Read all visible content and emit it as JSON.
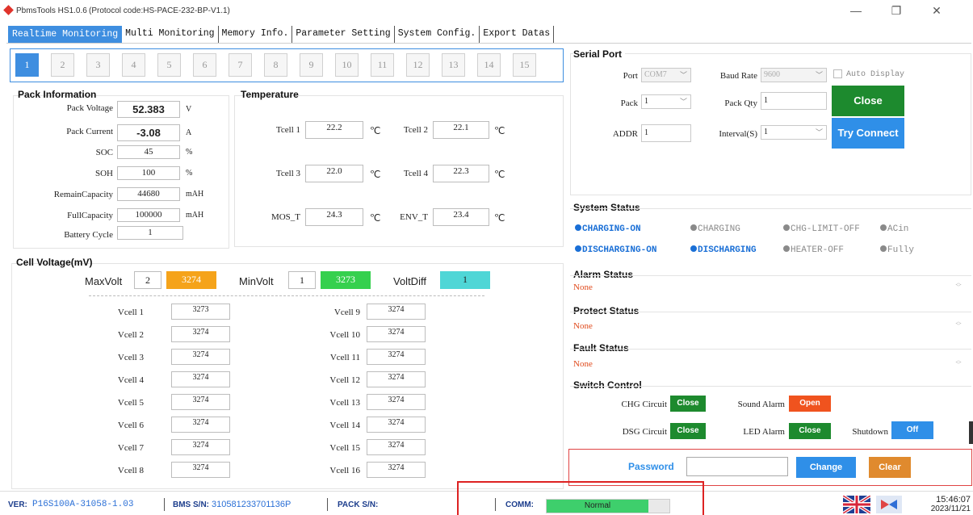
{
  "window": {
    "app_title": "PbmsTools HS1.0.6",
    "protocol": "(Protocol code:HS-PACE-232-BP-V1.1)",
    "minimize": "—",
    "maximize": "❐",
    "close": "✕"
  },
  "tabs": [
    "Realtime Monitoring",
    "Multi Monitoring",
    "Memory Info.",
    "Parameter Setting",
    "System Config.",
    "Export Datas"
  ],
  "pack_tiles": [
    "1",
    "2",
    "3",
    "4",
    "5",
    "6",
    "7",
    "8",
    "9",
    "10",
    "11",
    "12",
    "13",
    "14",
    "15"
  ],
  "pack_info": {
    "title": "Pack Information",
    "pack_voltage_label": "Pack Voltage",
    "pack_voltage": "52.383",
    "pack_voltage_unit": "V",
    "pack_current_label": "Pack Current",
    "pack_current": "-3.08",
    "pack_current_unit": "A",
    "soc_label": "SOC",
    "soc": "45",
    "soc_unit": "%",
    "soh_label": "SOH",
    "soh": "100",
    "soh_unit": "%",
    "remain_label": "RemainCapacity",
    "remain": "44680",
    "remain_unit": "mAH",
    "full_label": "FullCapacity",
    "full": "100000",
    "full_unit": "mAH",
    "cycle_label": "Battery Cycle",
    "cycle": "1"
  },
  "temperature": {
    "title": "Temperature",
    "unit": "℃",
    "tcell1_label": "Tcell 1",
    "tcell1": "22.2",
    "tcell2_label": "Tcell 2",
    "tcell2": "22.1",
    "tcell3_label": "Tcell 3",
    "tcell3": "22.0",
    "tcell4_label": "Tcell 4",
    "tcell4": "22.3",
    "mos_label": "MOS_T",
    "mos": "24.3",
    "env_label": "ENV_T",
    "env": "23.4"
  },
  "cell_voltage": {
    "title": "Cell Voltage(mV)",
    "maxvolt_label": "MaxVolt",
    "maxvolt_cell": "2",
    "maxvolt_value": "3274",
    "minvolt_label": "MinVolt",
    "minvolt_cell": "1",
    "minvolt_value": "3273",
    "voltdiff_label": "VoltDiff",
    "voltdiff_value": "1",
    "colors": {
      "max": "#f5a31a",
      "min": "#35d04e",
      "diff": "#4fd6d6"
    },
    "cells": [
      {
        "label": "Vcell 1",
        "value": "3273"
      },
      {
        "label": "Vcell 2",
        "value": "3274"
      },
      {
        "label": "Vcell 3",
        "value": "3274"
      },
      {
        "label": "Vcell 4",
        "value": "3274"
      },
      {
        "label": "Vcell 5",
        "value": "3274"
      },
      {
        "label": "Vcell 6",
        "value": "3274"
      },
      {
        "label": "Vcell 7",
        "value": "3274"
      },
      {
        "label": "Vcell 8",
        "value": "3274"
      },
      {
        "label": "Vcell 9",
        "value": "3274"
      },
      {
        "label": "Vcell 10",
        "value": "3274"
      },
      {
        "label": "Vcell 11",
        "value": "3274"
      },
      {
        "label": "Vcell 12",
        "value": "3274"
      },
      {
        "label": "Vcell 13",
        "value": "3274"
      },
      {
        "label": "Vcell 14",
        "value": "3274"
      },
      {
        "label": "Vcell 15",
        "value": "3274"
      },
      {
        "label": "Vcell 16",
        "value": "3274"
      }
    ]
  },
  "serial": {
    "title": "Serial Port",
    "port_label": "Port",
    "port": "COM7",
    "baud_label": "Baud Rate",
    "baud": "9600",
    "auto_display": "Auto Display",
    "pack_label": "Pack",
    "pack": "1",
    "pack_qty_label": "Pack Qty",
    "pack_qty": "1",
    "close_btn": "Close",
    "addr_label": "ADDR",
    "addr": "1",
    "interval_label": "Interval(S)",
    "interval": "1",
    "try_connect_btn": "Try Connect"
  },
  "system_status": {
    "title": "System Status",
    "items": [
      {
        "label": "CHARGING-ON",
        "active": true
      },
      {
        "label": "CHARGING",
        "active": false
      },
      {
        "label": "CHG-LIMIT-OFF",
        "active": false
      },
      {
        "label": "ACin",
        "active": false
      },
      {
        "label": "DISCHARGING-ON",
        "active": true
      },
      {
        "label": "DISCHARGING",
        "active": true
      },
      {
        "label": "HEATER-OFF",
        "active": false
      },
      {
        "label": "Fully",
        "active": false
      }
    ],
    "colors": {
      "active": "#1a6fd6",
      "inactive": "#8a8a8a"
    }
  },
  "alarm": {
    "title": "Alarm Status",
    "value": "None"
  },
  "protect": {
    "title": "Protect Status",
    "value": "None"
  },
  "fault": {
    "title": "Fault Status",
    "value": "None"
  },
  "switch_control": {
    "title": "Switch Control",
    "chg_label": "CHG Circuit",
    "chg_btn": "Close",
    "sound_label": "Sound Alarm",
    "sound_btn": "Open",
    "dsg_label": "DSG Circuit",
    "dsg_btn": "Close",
    "led_label": "LED Alarm",
    "led_btn": "Close",
    "shutdown_label": "Shutdown",
    "shutdown_btn": "Off"
  },
  "password": {
    "label": "Password",
    "value": "",
    "change_btn": "Change",
    "clear_btn": "Clear"
  },
  "footer": {
    "ver_label": "VER:",
    "ver": "P16S100A-31058-1.03",
    "bms_label": "BMS S/N:",
    "bms": "310581233701136P",
    "pack_label": "PACK S/N:",
    "pack": "",
    "comm_label": "COMM:",
    "comm": "Normal",
    "time": "15:46:07",
    "date": "2023/11/21"
  }
}
